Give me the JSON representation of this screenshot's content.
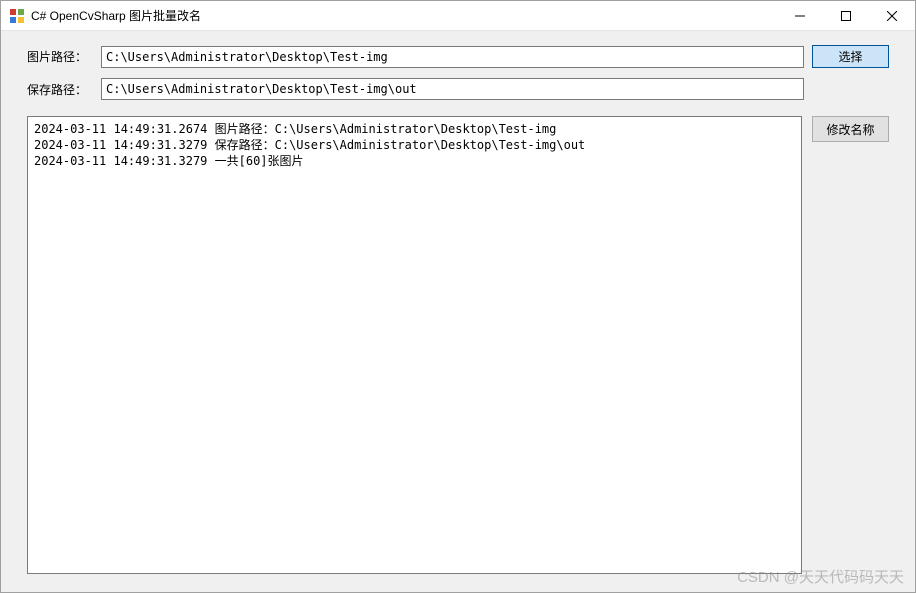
{
  "titlebar": {
    "title": "C# OpenCvSharp 图片批量改名"
  },
  "form": {
    "image_path_label": "图片路径：",
    "image_path_value": "C:\\Users\\Administrator\\Desktop\\Test-img",
    "save_path_label": "保存路径：",
    "save_path_value": "C:\\Users\\Administrator\\Desktop\\Test-img\\out",
    "select_button_label": "选择",
    "rename_button_label": "修改名称"
  },
  "log": {
    "lines": [
      "2024-03-11 14:49:31.2674 图片路径：C:\\Users\\Administrator\\Desktop\\Test-img",
      "2024-03-11 14:49:31.3279 保存路径：C:\\Users\\Administrator\\Desktop\\Test-img\\out",
      "2024-03-11 14:49:31.3279 一共[60]张图片"
    ]
  },
  "watermark": "CSDN @天天代码码天天"
}
